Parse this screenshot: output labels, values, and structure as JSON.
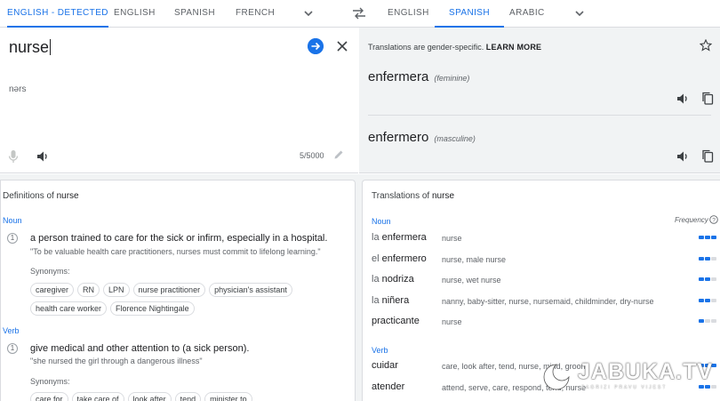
{
  "source_langs": [
    {
      "label": "English - detected",
      "active": true
    },
    {
      "label": "English",
      "active": false
    },
    {
      "label": "Spanish",
      "active": false
    },
    {
      "label": "French",
      "active": false
    }
  ],
  "target_langs": [
    {
      "label": "English",
      "active": false
    },
    {
      "label": "Spanish",
      "active": true
    },
    {
      "label": "Arabic",
      "active": false
    }
  ],
  "source": {
    "text": "nurse",
    "transliteration": "nərs",
    "char_count": "5/5000"
  },
  "target": {
    "notice": "Translations are gender-specific.",
    "learn_more": "LEARN MORE",
    "results": [
      {
        "word": "enfermera",
        "gender": "(feminine)"
      },
      {
        "word": "enfermero",
        "gender": "(masculine)"
      }
    ]
  },
  "definitions": {
    "title_prefix": "Definitions of",
    "word": "nurse",
    "noun_label": "Noun",
    "noun_num": "1",
    "noun_gloss": "a person trained to care for the sick or infirm, especially in a hospital.",
    "noun_example": "\"To be valuable health care practitioners, nurses must commit to lifelong learning.\"",
    "synonyms_label": "Synonyms:",
    "noun_synonyms_row1": [
      "caregiver",
      "RN",
      "LPN",
      "nurse practitioner",
      "physician's assistant"
    ],
    "noun_synonyms_row2": [
      "health care worker",
      "Florence Nightingale"
    ],
    "verb_label": "Verb",
    "verb_num": "1",
    "verb_gloss": "give medical and other attention to (a sick person).",
    "verb_example": "\"she nursed the girl through a dangerous illness\"",
    "verb_synonyms": [
      "care for",
      "take care of",
      "look after",
      "tend",
      "minister to"
    ]
  },
  "translations": {
    "title_prefix": "Translations of",
    "word": "nurse",
    "frequency_label": "Frequency",
    "noun_label": "Noun",
    "noun_rows": [
      {
        "article": "la",
        "word": "enfermera",
        "reverse": "nurse",
        "freq": 3
      },
      {
        "article": "el",
        "word": "enfermero",
        "reverse": "nurse, male nurse",
        "freq": 2
      },
      {
        "article": "la",
        "word": "nodriza",
        "reverse": "nurse, wet nurse",
        "freq": 2
      },
      {
        "article": "la",
        "word": "niñera",
        "reverse": "nanny, baby-sitter, nurse, nursemaid, childminder, dry-nurse",
        "freq": 2
      },
      {
        "article": "",
        "word": "practicante",
        "reverse": "nurse",
        "freq": 1
      }
    ],
    "verb_label": "Verb",
    "verb_rows": [
      {
        "article": "",
        "word": "cuidar",
        "reverse": "care, look after, tend, nurse, mind, groom",
        "freq": 3
      },
      {
        "article": "",
        "word": "atender",
        "reverse": "attend, serve, care, respond, tend, nurse",
        "freq": 2
      }
    ]
  },
  "watermark": {
    "brand": "JABUKA.TV",
    "tagline": "ZAGRIZI PRAVU VIJEST"
  },
  "colors": {
    "accent": "#1a73e8",
    "panel_grey": "#f1f3f4",
    "divider": "#dadce0"
  }
}
